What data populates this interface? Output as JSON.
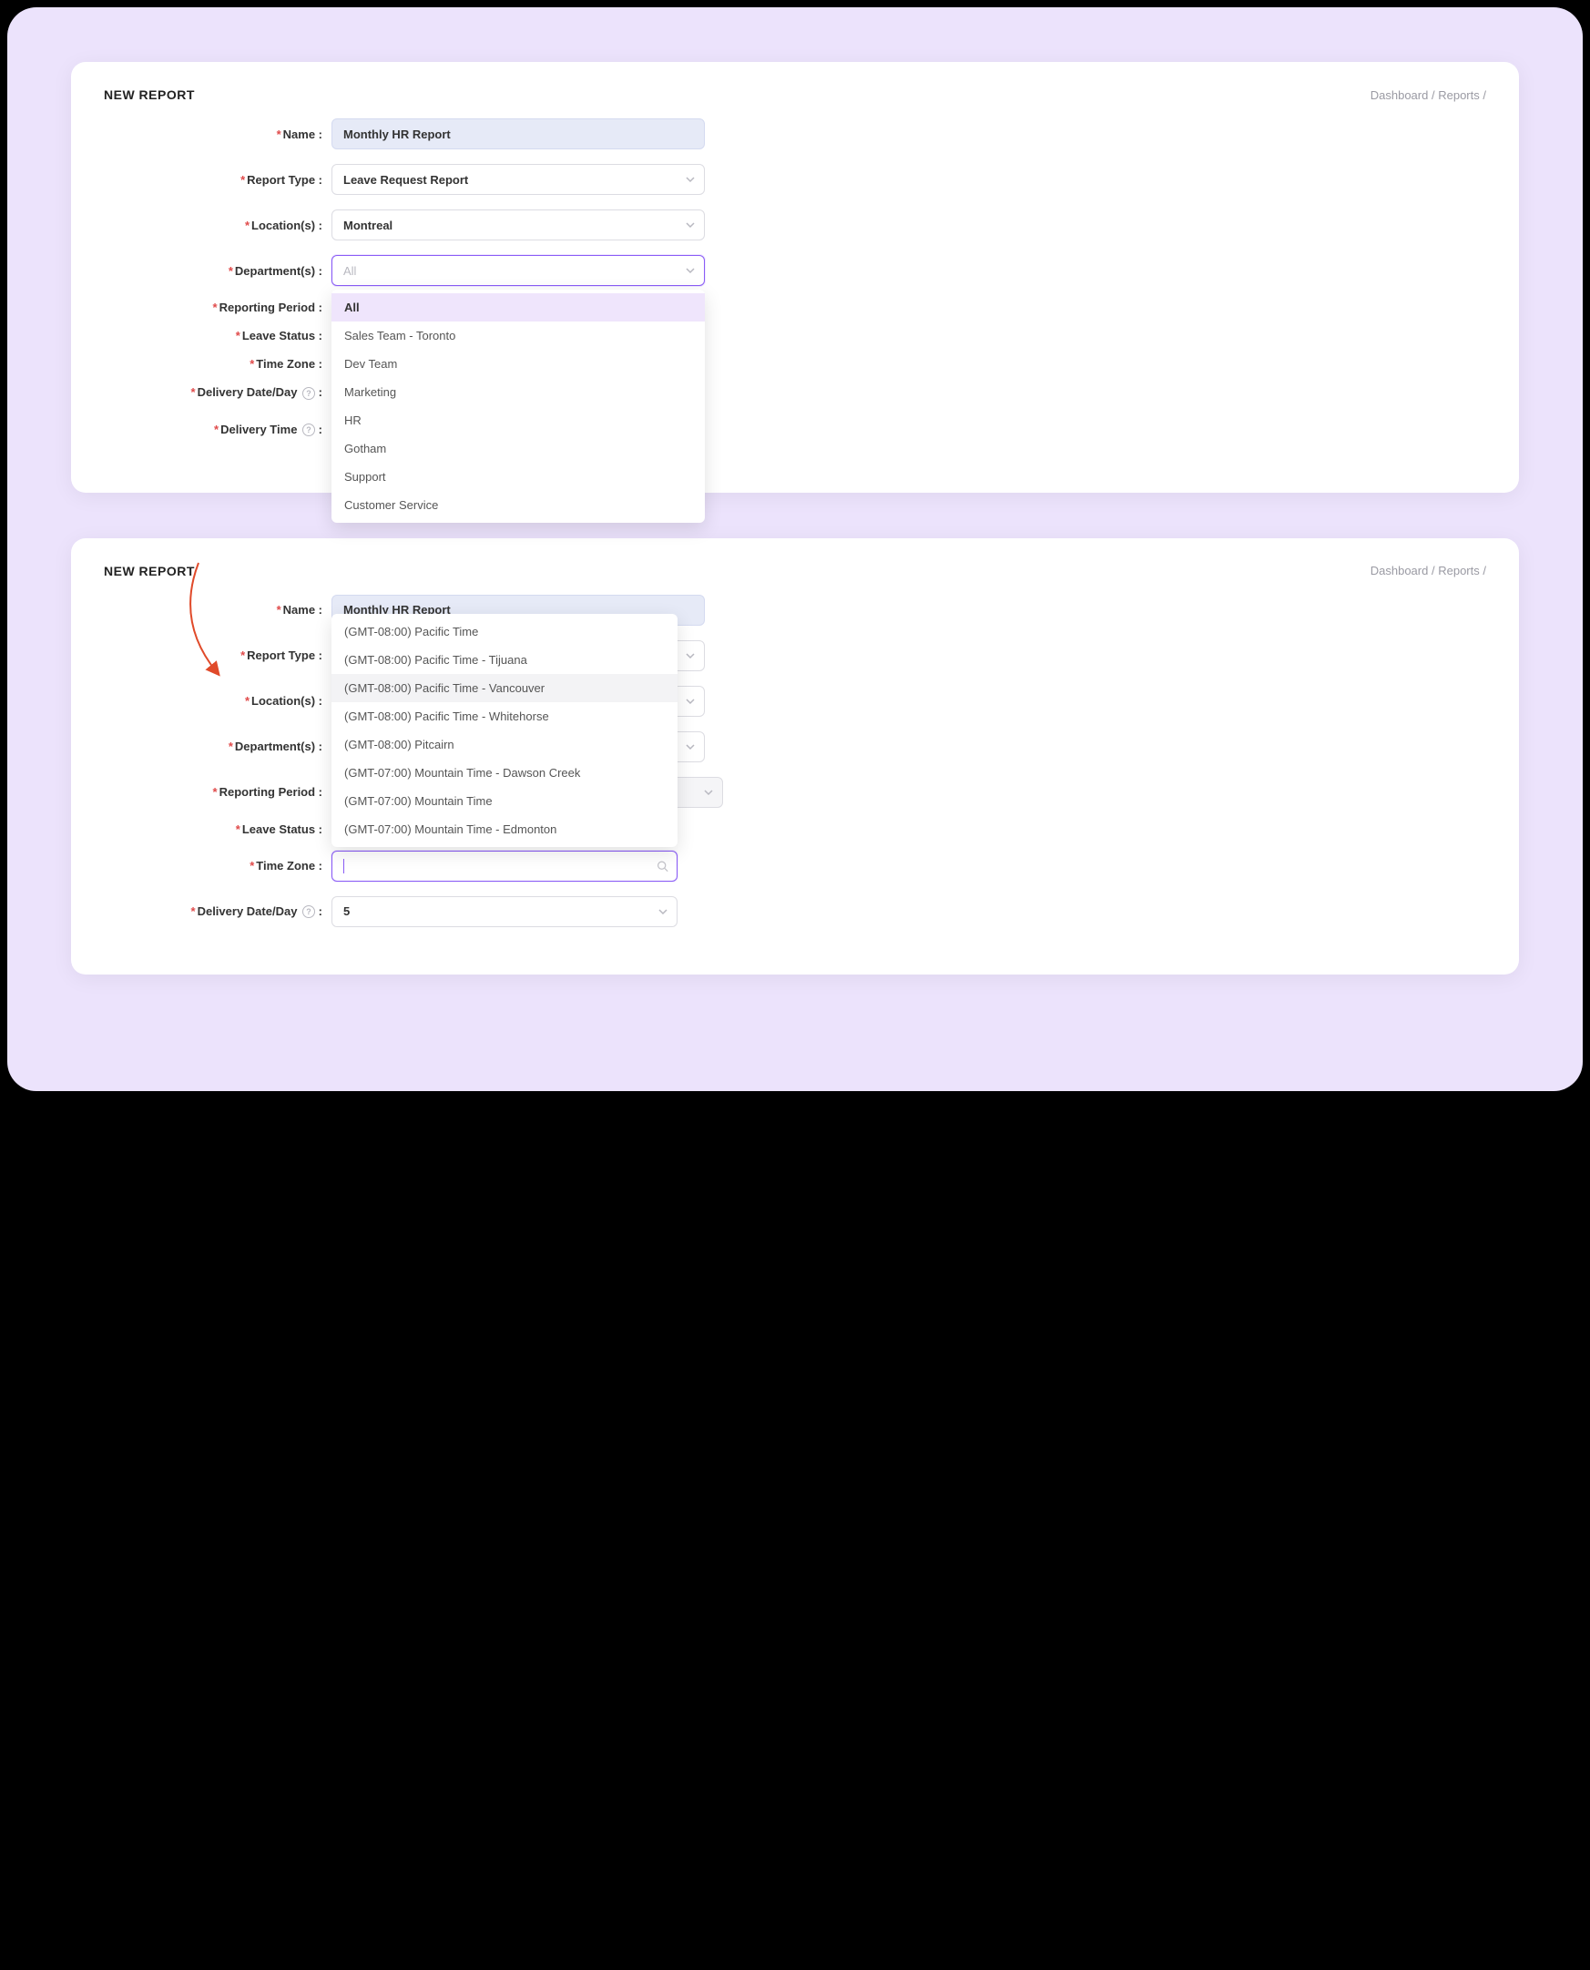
{
  "panel1": {
    "title": "NEW REPORT",
    "breadcrumb": {
      "dashboard": "Dashboard",
      "reports": "Reports",
      "sep": "/"
    },
    "labels": {
      "name": "Name :",
      "report_type": "Report Type :",
      "locations": "Location(s) :",
      "departments": "Department(s) :",
      "reporting_period": "Reporting Period :",
      "leave_status": "Leave Status :",
      "time_zone": "Time Zone :",
      "delivery_date": "Delivery Date/Day",
      "delivery_time": "Delivery Time"
    },
    "values": {
      "name": "Monthly HR Report",
      "report_type": "Leave Request Report",
      "locations": "Montreal",
      "departments_placeholder": "All"
    },
    "department_options": [
      "All",
      "Sales Team - Toronto",
      "Dev Team",
      "Marketing",
      "HR",
      "Gotham",
      "Support",
      "Customer Service"
    ]
  },
  "panel2": {
    "title": "NEW REPORT",
    "breadcrumb": {
      "dashboard": "Dashboard",
      "reports": "Reports",
      "sep": "/"
    },
    "labels": {
      "name": "Name :",
      "report_type": "Report Type :",
      "locations": "Location(s) :",
      "departments": "Department(s) :",
      "reporting_period": "Reporting Period :",
      "leave_status": "Leave Status :",
      "time_zone": "Time Zone :",
      "delivery_date": "Delivery Date/Day"
    },
    "values": {
      "name": "Monthly HR Report",
      "delivery_date": "5"
    },
    "timezone_options": [
      "(GMT-08:00) Pacific Time",
      "(GMT-08:00) Pacific Time - Tijuana",
      "(GMT-08:00) Pacific Time - Vancouver",
      "(GMT-08:00) Pacific Time - Whitehorse",
      "(GMT-08:00) Pitcairn",
      "(GMT-07:00) Mountain Time - Dawson Creek",
      "(GMT-07:00) Mountain Time",
      "(GMT-07:00) Mountain Time - Edmonton"
    ],
    "timezone_hover_index": 2
  }
}
